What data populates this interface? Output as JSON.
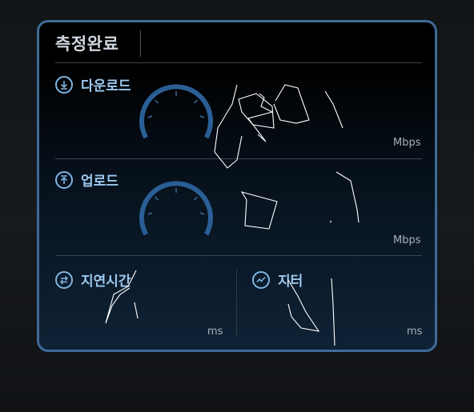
{
  "header": {
    "title": "측정완료"
  },
  "download": {
    "label": "다운로드",
    "unit": "Mbps",
    "icon": "download-icon"
  },
  "upload": {
    "label": "업로드",
    "unit": "Mbps",
    "icon": "upload-icon"
  },
  "latency": {
    "label": "지연시간",
    "unit": "ms",
    "icon": "swap-arrows-icon"
  },
  "jitter": {
    "label": "지터",
    "unit": "ms",
    "icon": "trend-line-icon"
  },
  "colors": {
    "accent": "#7fb5e2",
    "gauge": "#2a5f95",
    "border": "#3f6a96"
  }
}
